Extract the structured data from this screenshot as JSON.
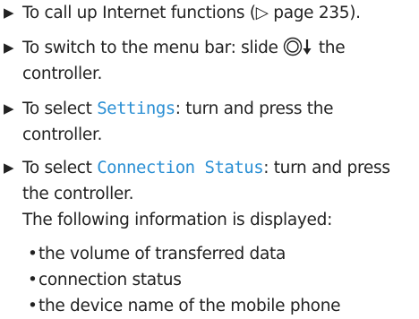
{
  "steps": [
    {
      "arrow": "▶",
      "text_before": "To call up Internet functions (",
      "page_ref_icon": "▷",
      "text_after": " page 235)."
    },
    {
      "arrow": "▶",
      "text_before": "To switch to the menu bar: slide ",
      "controller_icon": "controller-slide-down-icon",
      "text_after": " the controller."
    },
    {
      "arrow": "▶",
      "text_before": "To select ",
      "ui_term": "Settings",
      "text_after": ": turn and press the controller."
    },
    {
      "arrow": "▶",
      "text_before": "To select ",
      "ui_term": "Connection Status",
      "text_after": ": turn and press the controller."
    }
  ],
  "info_intro": "The following information is displayed:",
  "bullets": [
    "the volume of transferred data",
    "connection status",
    "the device name of the mobile phone"
  ],
  "colors": {
    "text": "#222222",
    "ui_term": "#2a8fd4"
  }
}
